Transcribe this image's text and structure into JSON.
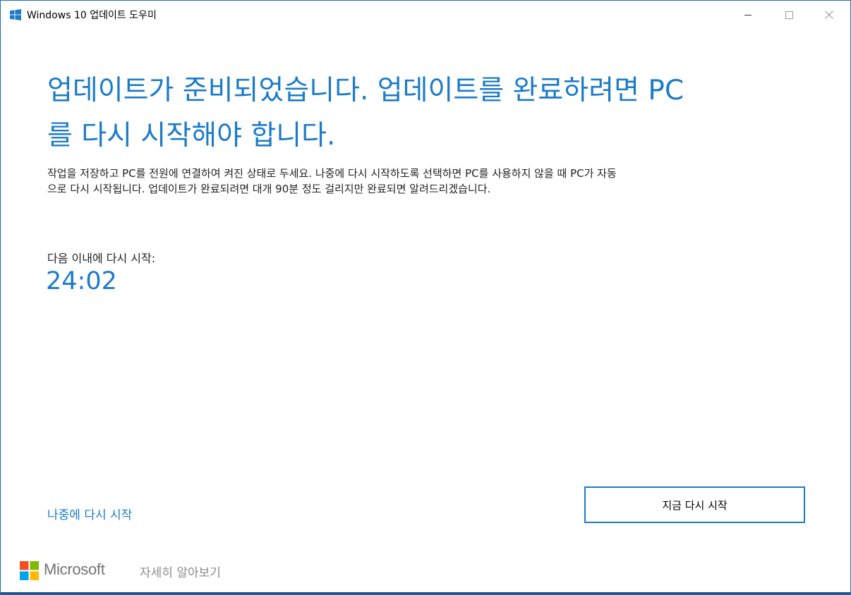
{
  "window": {
    "title": "Windows 10 업데이트 도우미",
    "controls": {
      "minimize_icon": "minimize-icon",
      "maximize_icon": "maximize-icon",
      "close_icon": "close-icon"
    }
  },
  "main": {
    "headline_line1": "업데이트가 준비되었습니다. 업데이트를 완료하려면 PC",
    "headline_line2": "를 다시 시작해야 합니다.",
    "body_line1": "작업을 저장하고 PC를 전원에 연결하여 켜진 상태로 두세요. 나중에 다시 시작하도록 선택하면 PC를 사용하지 않을 때 PC가 자동",
    "body_line2": "으로 다시 시작됩니다. 업데이트가 완료되려면 대개 90분 정도 걸리지만 완료되면 알려드리겠습니다.",
    "countdown_label": "다음 이내에 다시 시작:",
    "countdown_value": "24:02"
  },
  "actions": {
    "restart_later": "나중에 다시 시작",
    "restart_now": "지금 다시 시작"
  },
  "footer": {
    "brand": "Microsoft",
    "learn_more": "자세히 알아보기"
  },
  "colors": {
    "accent": "#1c7bc8",
    "window_border": "#1e6fba",
    "ms_red": "#f25022",
    "ms_green": "#7fba00",
    "ms_blue": "#00a4ef",
    "ms_yellow": "#ffb900"
  }
}
